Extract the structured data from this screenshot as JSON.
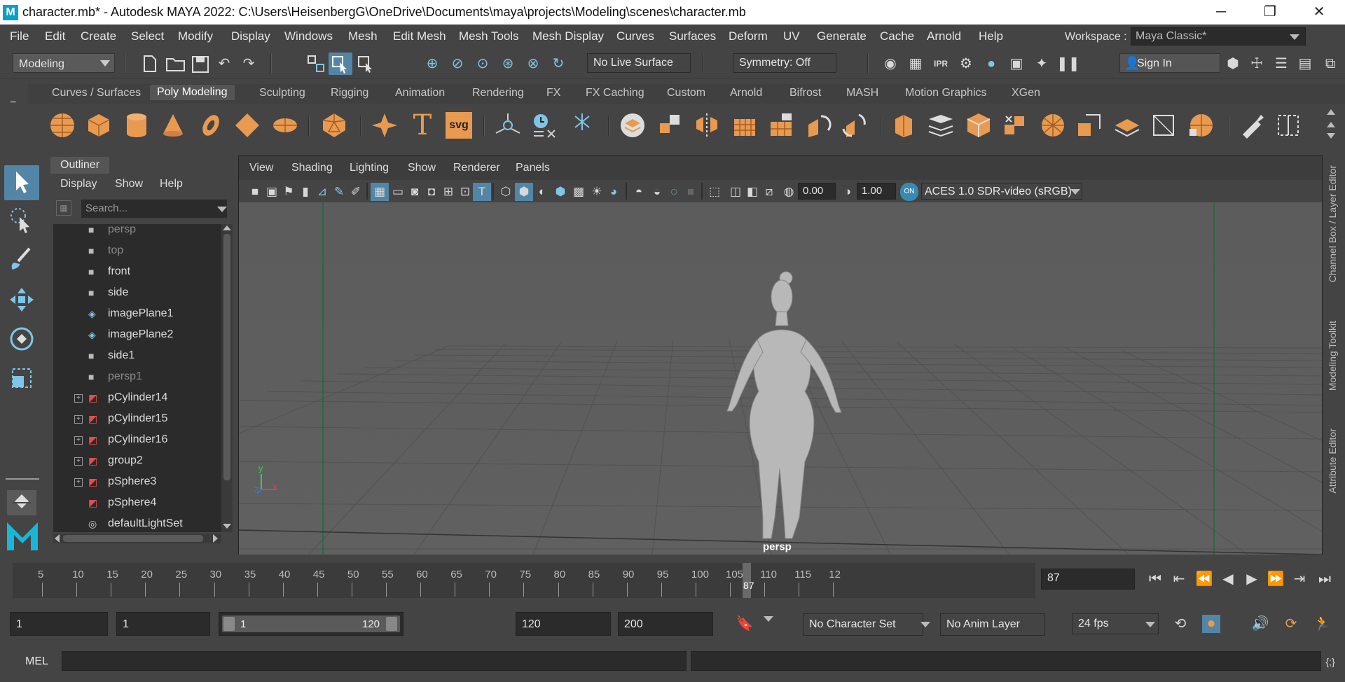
{
  "window": {
    "title": "character.mb* - Autodesk MAYA 2022: C:\\Users\\HeisenbergG\\OneDrive\\Documents\\maya\\projects\\Modeling\\scenes\\character.mb",
    "logo": "M",
    "minimize": "─",
    "maximize": "❐",
    "close": "✕"
  },
  "menubar": {
    "items": [
      "File",
      "Edit",
      "Create",
      "Select",
      "Modify",
      "Display",
      "Windows",
      "Mesh",
      "Edit Mesh",
      "Mesh Tools",
      "Mesh Display",
      "Curves",
      "Surfaces",
      "Deform",
      "UV",
      "Generate",
      "Cache",
      "Arnold",
      "Help"
    ],
    "workspace_label": "Workspace :",
    "workspace_value": "Maya Classic*"
  },
  "statusline": {
    "menuset": "Modeling",
    "live_surface": "No Live Surface",
    "symmetry": "Symmetry: Off",
    "sign_in": "Sign In"
  },
  "shelf": {
    "tabs": [
      "Curves / Surfaces",
      "Poly Modeling",
      "Sculpting",
      "Rigging",
      "Animation",
      "Rendering",
      "FX",
      "FX Caching",
      "Custom",
      "Arnold",
      "Bifrost",
      "MASH",
      "Motion Graphics",
      "XGen"
    ],
    "active_tab": "Poly Modeling",
    "text_icon": "T",
    "svg_icon": "svg",
    "coord_icon": "0,0,0"
  },
  "outliner": {
    "title": "Outliner",
    "menu": [
      "Display",
      "Show",
      "Help"
    ],
    "search_placeholder": "Search...",
    "items": [
      {
        "label": "persp",
        "icon": "camera-icon",
        "dim": true,
        "expand": false
      },
      {
        "label": "top",
        "icon": "camera-icon",
        "dim": true,
        "expand": false
      },
      {
        "label": "front",
        "icon": "camera-icon",
        "dim": false,
        "expand": false
      },
      {
        "label": "side",
        "icon": "camera-icon",
        "dim": false,
        "expand": false
      },
      {
        "label": "imagePlane1",
        "icon": "image-plane-icon",
        "dim": false,
        "expand": false
      },
      {
        "label": "imagePlane2",
        "icon": "image-plane-icon",
        "dim": false,
        "expand": false
      },
      {
        "label": "side1",
        "icon": "camera-icon",
        "dim": false,
        "expand": false
      },
      {
        "label": "persp1",
        "icon": "camera-icon",
        "dim": true,
        "expand": false
      },
      {
        "label": "pCylinder14",
        "icon": "mesh-icon",
        "dim": false,
        "expand": true
      },
      {
        "label": "pCylinder15",
        "icon": "mesh-icon",
        "dim": false,
        "expand": true
      },
      {
        "label": "pCylinder16",
        "icon": "mesh-icon",
        "dim": false,
        "expand": true
      },
      {
        "label": "group2",
        "icon": "mesh-icon",
        "dim": false,
        "expand": true
      },
      {
        "label": "pSphere3",
        "icon": "mesh-icon",
        "dim": false,
        "expand": true
      },
      {
        "label": "pSphere4",
        "icon": "mesh-icon",
        "dim": false,
        "expand": false
      },
      {
        "label": "defaultLightSet",
        "icon": "set-icon",
        "dim": false,
        "expand": false
      }
    ]
  },
  "viewport": {
    "menu": [
      "View",
      "Shading",
      "Lighting",
      "Show",
      "Renderer",
      "Panels"
    ],
    "exposure": "0.00",
    "gamma": "1.00",
    "color_space": "ACES 1.0 SDR-video (sRGB)",
    "camera_label": "persp",
    "axis_y": "y",
    "axis_x": "x",
    "axis_z": "z"
  },
  "rightbar": {
    "tabs": [
      "Channel Box / Layer Editor",
      "Modeling Toolkit",
      "Attribute Editor"
    ]
  },
  "timeline": {
    "ticks": [
      "5",
      "10",
      "15",
      "20",
      "25",
      "30",
      "35",
      "40",
      "45",
      "50",
      "55",
      "60",
      "65",
      "70",
      "75",
      "80",
      "85",
      "90",
      "95",
      "100",
      "105",
      "110",
      "115",
      "12"
    ],
    "current_frame": "87",
    "current_frame_field": "87"
  },
  "range": {
    "start": "1",
    "playback_start": "1",
    "range_start": "1",
    "range_end": "120",
    "playback_end": "120",
    "end": "200",
    "character_set": "No Character Set",
    "anim_layer": "No Anim Layer",
    "fps": "24 fps"
  },
  "cmdline": {
    "label": "MEL"
  },
  "colors": {
    "accent_orange": "#e89a50",
    "tool_blue": "#7fc6e6",
    "selected_blue": "#5285a6"
  }
}
